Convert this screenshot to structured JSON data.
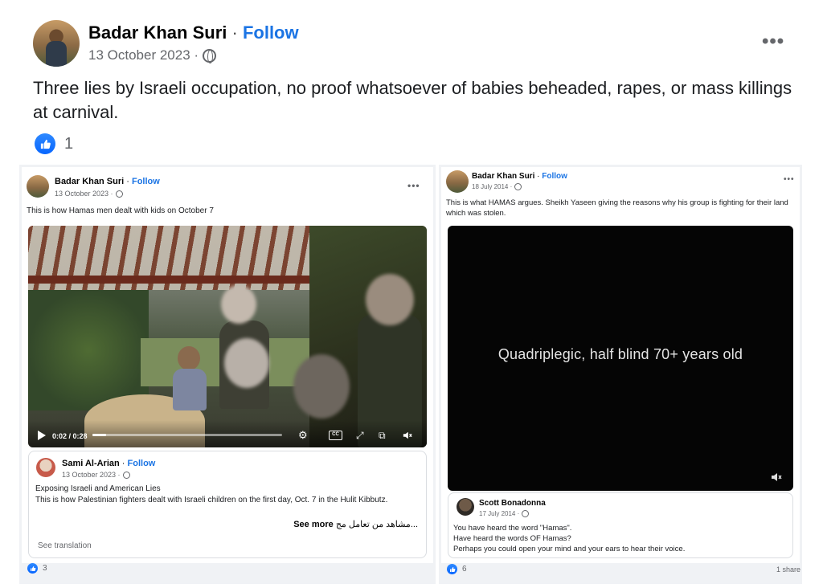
{
  "main_post": {
    "author": "Badar Khan Suri",
    "separator": "·",
    "follow": "Follow",
    "date": "13 October 2023 ·",
    "text": "Three lies by Israeli occupation, no proof whatsoever of babies beheaded, rapes, or mass killings at carnival.",
    "like_count": "1",
    "more": "•••"
  },
  "left_shot": {
    "author": "Badar Khan Suri",
    "separator": "·",
    "follow": "Follow",
    "date": "13 October 2023 ·",
    "more": "•••",
    "text": "This is how Hamas men dealt with kids on October 7",
    "video": {
      "time": "0:02 / 0:28",
      "progress_fraction": 0.07,
      "cc": "CC"
    },
    "shared": {
      "author": "Sami Al-Arian",
      "separator": "·",
      "follow": "Follow",
      "date": "13 October 2023 ·",
      "line1": "Exposing Israeli and American Lies",
      "line2": "This is how Palestinian fighters dealt with Israeli children on the first day, Oct. 7 in the Hulit Kibbutz.",
      "rtl_text": "مشاهد من تعامل مج...",
      "see_more": "See more",
      "see_translation": "See translation"
    },
    "reaction_count": "3"
  },
  "right_shot": {
    "author": "Badar Khan Suri",
    "separator": "·",
    "follow": "Follow",
    "date": "18 July 2014 ·",
    "more": "•••",
    "text": "This is what HAMAS argues. Sheikh Yaseen giving the reasons why his group is fighting for their land which was stolen.",
    "video_caption": "Quadriplegic, half blind 70+ years old",
    "shared": {
      "author": "Scott Bonadonna",
      "date": "17 July 2014 ·",
      "line1": "You have heard the word \"Hamas\".",
      "line2": "Have heard the words OF Hamas?",
      "line3": "Perhaps you could open your mind and your ears to hear their voice."
    },
    "reaction_count": "6",
    "share_count": "1 share"
  },
  "colors": {
    "follow_blue": "#1b74e4",
    "like_blue": "#0866ff",
    "muted_text": "#65676b",
    "background_gray": "#f0f2f5"
  }
}
